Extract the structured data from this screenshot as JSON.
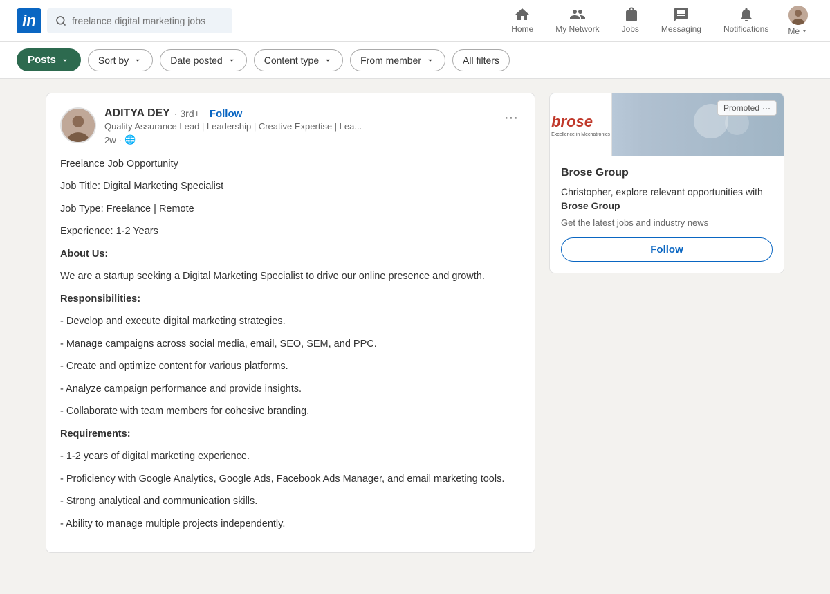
{
  "nav": {
    "logo_text": "in",
    "search_placeholder": "freelance digital marketing jobs",
    "items": [
      {
        "id": "home",
        "label": "Home",
        "icon": "home"
      },
      {
        "id": "my-network",
        "label": "My Network",
        "icon": "network"
      },
      {
        "id": "jobs",
        "label": "Jobs",
        "icon": "jobs"
      },
      {
        "id": "messaging",
        "label": "Messaging",
        "icon": "messaging"
      },
      {
        "id": "notifications",
        "label": "Notifications",
        "icon": "bell"
      }
    ],
    "me_label": "Me"
  },
  "filters": {
    "posts_label": "Posts",
    "sort_by_label": "Sort by",
    "date_posted_label": "Date posted",
    "content_type_label": "Content type",
    "from_member_label": "From member",
    "all_filters_label": "All filters"
  },
  "post": {
    "author_name": "ADITYA DEY",
    "author_degree": "· 3rd+",
    "author_title": "Quality Assurance Lead | Leadership | Creative Expertise | Lea...",
    "post_time": "2w",
    "follow_label": "Follow",
    "job_opportunity": "Freelance Job Opportunity",
    "job_title_line": "Job Title: Digital Marketing Specialist",
    "job_type_line": "Job Type: Freelance | Remote",
    "experience_line": "Experience: 1-2 Years",
    "about_heading": "About Us:",
    "about_text": "We are a startup seeking a Digital Marketing Specialist to drive our online presence and growth.",
    "responsibilities_heading": "Responsibilities:",
    "responsibilities": [
      "- Develop and execute digital marketing strategies.",
      "- Manage campaigns across social media, email, SEO, SEM, and PPC.",
      "- Create and optimize content for various platforms.",
      "- Analyze campaign performance and provide insights.",
      "- Collaborate with team members for cohesive branding."
    ],
    "requirements_heading": "Requirements:",
    "requirements": [
      "- 1-2 years of digital marketing experience.",
      "- Proficiency with Google Analytics, Google Ads, Facebook Ads Manager, and email marketing tools.",
      "- Strong analytical and communication skills.",
      "- Ability to manage multiple projects independently."
    ]
  },
  "sidebar": {
    "promoted_label": "Promoted",
    "company_name": "Brose Group",
    "company_sub": "Excellence in Mechatronics",
    "promo_desc_prefix": "Christopher, explore relevant opportunities with ",
    "promo_desc_bold": "Brose Group",
    "promo_cta": "Get the latest jobs and industry news",
    "follow_label": "Follow"
  }
}
